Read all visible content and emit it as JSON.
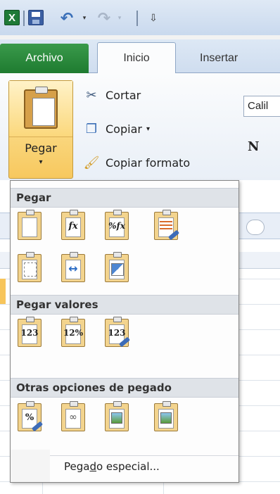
{
  "quick_access": {
    "app_icon": "excel-logo-icon",
    "app_letter": "X",
    "undo_dropdown": "▾",
    "redo_dropdown": "▾",
    "customize": "⇩"
  },
  "tabs": [
    {
      "label": "Archivo"
    },
    {
      "label": "Inicio"
    },
    {
      "label": "Insertar"
    }
  ],
  "clipboard": {
    "paste_label": "Pegar",
    "paste_arrow": "▾",
    "cut_label": "Cortar",
    "copy_label": "Copiar",
    "copy_arrow": "▾",
    "format_painter_label": "Copiar formato"
  },
  "font": {
    "name_box": "Calil",
    "bold_glyph": "N"
  },
  "paste_menu": {
    "sections": [
      {
        "title": "Pegar"
      },
      {
        "title": "Pegar valores"
      },
      {
        "title": "Otras opciones de pegado"
      }
    ],
    "icon_glyphs": {
      "formulas": "fx",
      "formulas_number_format": "%fx",
      "values": "123",
      "values_number_format": "12%",
      "values_source_format": "123",
      "formatting": "%",
      "link": "∞",
      "transpose_arrows": "↔"
    },
    "special_prefix": "Pega",
    "special_underlined": "d",
    "special_suffix": "o especial..."
  },
  "colors": {
    "file_tab": "#1e7b30",
    "paste_highlight": "#f7c85e",
    "menu_header": "#dfe3e8"
  }
}
